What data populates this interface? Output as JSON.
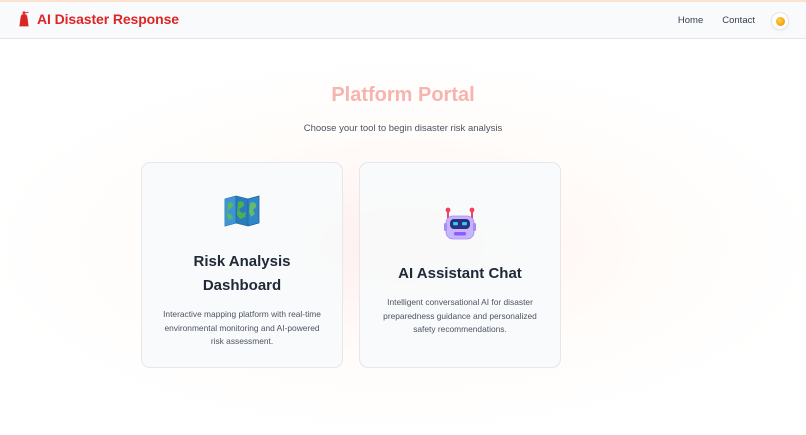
{
  "navbar": {
    "brand_name": "AI Disaster Response",
    "brand_icon": "fire-extinguisher-icon",
    "links": [
      "Home",
      "Contact"
    ],
    "theme_toggle_icon": "sun-icon"
  },
  "hero": {
    "title": "Platform Portal",
    "subtitle": "Choose your tool to begin disaster risk analysis"
  },
  "cards": [
    {
      "icon": "map-icon",
      "title": "Risk Analysis Dashboard",
      "description": "Interactive mapping platform with real-time environmental monitoring and AI-powered risk assessment."
    },
    {
      "icon": "robot-icon",
      "title": "AI Assistant Chat",
      "description": "Intelligent conversational AI for disaster preparedness guidance and personalized safety recommendations."
    }
  ],
  "colors": {
    "brand": "#dc2626",
    "title": "#f7b4ae",
    "navbar_bg": "#f9fafb"
  }
}
